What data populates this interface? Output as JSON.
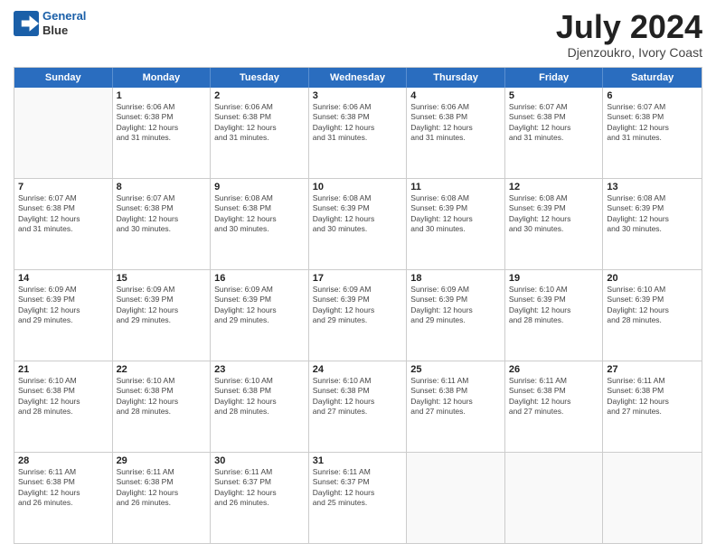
{
  "header": {
    "logo_line1": "General",
    "logo_line2": "Blue",
    "month": "July 2024",
    "location": "Djenzoukro, Ivory Coast"
  },
  "days_of_week": [
    "Sunday",
    "Monday",
    "Tuesday",
    "Wednesday",
    "Thursday",
    "Friday",
    "Saturday"
  ],
  "weeks": [
    [
      {
        "day": "",
        "info": ""
      },
      {
        "day": "1",
        "info": "Sunrise: 6:06 AM\nSunset: 6:38 PM\nDaylight: 12 hours\nand 31 minutes."
      },
      {
        "day": "2",
        "info": "Sunrise: 6:06 AM\nSunset: 6:38 PM\nDaylight: 12 hours\nand 31 minutes."
      },
      {
        "day": "3",
        "info": "Sunrise: 6:06 AM\nSunset: 6:38 PM\nDaylight: 12 hours\nand 31 minutes."
      },
      {
        "day": "4",
        "info": "Sunrise: 6:06 AM\nSunset: 6:38 PM\nDaylight: 12 hours\nand 31 minutes."
      },
      {
        "day": "5",
        "info": "Sunrise: 6:07 AM\nSunset: 6:38 PM\nDaylight: 12 hours\nand 31 minutes."
      },
      {
        "day": "6",
        "info": "Sunrise: 6:07 AM\nSunset: 6:38 PM\nDaylight: 12 hours\nand 31 minutes."
      }
    ],
    [
      {
        "day": "7",
        "info": "Sunrise: 6:07 AM\nSunset: 6:38 PM\nDaylight: 12 hours\nand 31 minutes."
      },
      {
        "day": "8",
        "info": "Sunrise: 6:07 AM\nSunset: 6:38 PM\nDaylight: 12 hours\nand 30 minutes."
      },
      {
        "day": "9",
        "info": "Sunrise: 6:08 AM\nSunset: 6:38 PM\nDaylight: 12 hours\nand 30 minutes."
      },
      {
        "day": "10",
        "info": "Sunrise: 6:08 AM\nSunset: 6:39 PM\nDaylight: 12 hours\nand 30 minutes."
      },
      {
        "day": "11",
        "info": "Sunrise: 6:08 AM\nSunset: 6:39 PM\nDaylight: 12 hours\nand 30 minutes."
      },
      {
        "day": "12",
        "info": "Sunrise: 6:08 AM\nSunset: 6:39 PM\nDaylight: 12 hours\nand 30 minutes."
      },
      {
        "day": "13",
        "info": "Sunrise: 6:08 AM\nSunset: 6:39 PM\nDaylight: 12 hours\nand 30 minutes."
      }
    ],
    [
      {
        "day": "14",
        "info": "Sunrise: 6:09 AM\nSunset: 6:39 PM\nDaylight: 12 hours\nand 29 minutes."
      },
      {
        "day": "15",
        "info": "Sunrise: 6:09 AM\nSunset: 6:39 PM\nDaylight: 12 hours\nand 29 minutes."
      },
      {
        "day": "16",
        "info": "Sunrise: 6:09 AM\nSunset: 6:39 PM\nDaylight: 12 hours\nand 29 minutes."
      },
      {
        "day": "17",
        "info": "Sunrise: 6:09 AM\nSunset: 6:39 PM\nDaylight: 12 hours\nand 29 minutes."
      },
      {
        "day": "18",
        "info": "Sunrise: 6:09 AM\nSunset: 6:39 PM\nDaylight: 12 hours\nand 29 minutes."
      },
      {
        "day": "19",
        "info": "Sunrise: 6:10 AM\nSunset: 6:39 PM\nDaylight: 12 hours\nand 28 minutes."
      },
      {
        "day": "20",
        "info": "Sunrise: 6:10 AM\nSunset: 6:39 PM\nDaylight: 12 hours\nand 28 minutes."
      }
    ],
    [
      {
        "day": "21",
        "info": "Sunrise: 6:10 AM\nSunset: 6:38 PM\nDaylight: 12 hours\nand 28 minutes."
      },
      {
        "day": "22",
        "info": "Sunrise: 6:10 AM\nSunset: 6:38 PM\nDaylight: 12 hours\nand 28 minutes."
      },
      {
        "day": "23",
        "info": "Sunrise: 6:10 AM\nSunset: 6:38 PM\nDaylight: 12 hours\nand 28 minutes."
      },
      {
        "day": "24",
        "info": "Sunrise: 6:10 AM\nSunset: 6:38 PM\nDaylight: 12 hours\nand 27 minutes."
      },
      {
        "day": "25",
        "info": "Sunrise: 6:11 AM\nSunset: 6:38 PM\nDaylight: 12 hours\nand 27 minutes."
      },
      {
        "day": "26",
        "info": "Sunrise: 6:11 AM\nSunset: 6:38 PM\nDaylight: 12 hours\nand 27 minutes."
      },
      {
        "day": "27",
        "info": "Sunrise: 6:11 AM\nSunset: 6:38 PM\nDaylight: 12 hours\nand 27 minutes."
      }
    ],
    [
      {
        "day": "28",
        "info": "Sunrise: 6:11 AM\nSunset: 6:38 PM\nDaylight: 12 hours\nand 26 minutes."
      },
      {
        "day": "29",
        "info": "Sunrise: 6:11 AM\nSunset: 6:38 PM\nDaylight: 12 hours\nand 26 minutes."
      },
      {
        "day": "30",
        "info": "Sunrise: 6:11 AM\nSunset: 6:37 PM\nDaylight: 12 hours\nand 26 minutes."
      },
      {
        "day": "31",
        "info": "Sunrise: 6:11 AM\nSunset: 6:37 PM\nDaylight: 12 hours\nand 25 minutes."
      },
      {
        "day": "",
        "info": ""
      },
      {
        "day": "",
        "info": ""
      },
      {
        "day": "",
        "info": ""
      }
    ]
  ]
}
